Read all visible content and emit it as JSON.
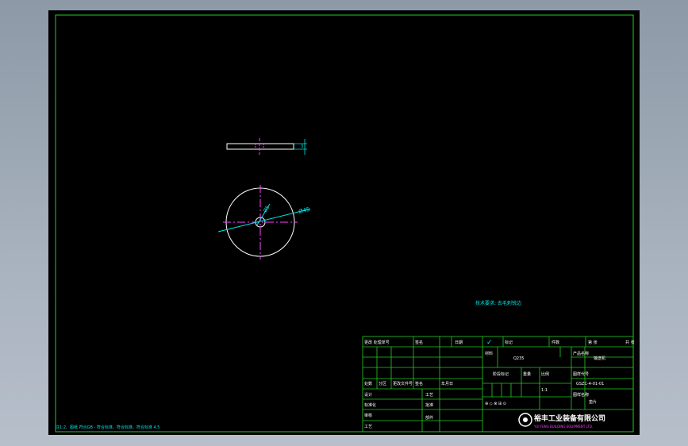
{
  "drawing": {
    "dimension_outer": "Ø45",
    "dimension_inner": "Ø5",
    "side_dimension": "3",
    "note": "技术要求: 去毛刺锐边"
  },
  "title_block": {
    "row_labels": [
      "处数",
      "分区",
      "更改文件号",
      "签名",
      "年月日"
    ],
    "cells": {
      "mark": "标记",
      "design": "设计",
      "standard": "标准化",
      "check": "审核",
      "process": "工艺",
      "approve": "批准",
      "stage_mark": "阶段标记",
      "weight": "重量",
      "ratio": "比例",
      "scale": "1:1",
      "material_label": "材料",
      "part_name_label": "图样名称",
      "part_name": "垫片",
      "drawing_no_label": "图样代号",
      "drawing_no": "GSZC-4-01-01",
      "sheet_count": "共 张",
      "sheet": "第 张",
      "product_label": "产品名称",
      "product": "输送机",
      "dept": "部件",
      "material": "Q235",
      "top_left": "更改 处理单号",
      "sign": "签名",
      "date": "日期",
      "part_count": "件数"
    },
    "company_cn": "裕丰工业装备有限公司",
    "company_en": "YUI FENG BUILDING EQUIPMENT LTD."
  },
  "footer_note": "注1:2、图纸 符合GB - 符合标准、符合标准、符合标准 4.5"
}
